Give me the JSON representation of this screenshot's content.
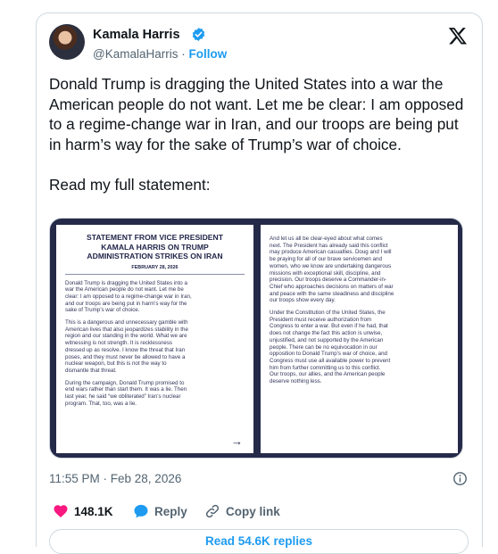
{
  "author": {
    "name": "Kamala Harris",
    "handle": "@KamalaHarris",
    "separator": "·",
    "follow_label": "Follow"
  },
  "tweet": {
    "text": "Donald Trump is dragging the United States into a war the American people do not want. Let me be clear: I am opposed to a regime-change war in Iran, and our troops are being put in harm’s way for the sake of Trump’s war of choice.\n\nRead my full statement:"
  },
  "statement": {
    "title": "STATEMENT FROM VICE PRESIDENT\nKAMALA HARRIS ON TRUMP\nADMINISTRATION STRIKES ON IRAN",
    "date": "FEBRUARY 28, 2026",
    "left_paragraphs": [
      "Donald Trump is dragging the United States into a\nwar the American people do not want. Let me be\nclear: I am opposed to a regime-change war in Iran,\nand our troops are being put in harm’s way for the\nsake of Trump’s war of choice.",
      "This is a dangerous and unnecessary gamble with\nAmerican lives that also jeopardizes stability in the\nregion and our standing in the world. What we are\nwitnessing is not strength. It is recklessness\ndressed up as resolve. I know the threat that Iran\nposes, and they must never be allowed to have a\nnuclear weapon, but this is not the way to\ndismantle that threat.",
      "During the campaign, Donald Trump promised to\nend wars rather than start them. It was a lie. Then\nlast year, he said “we obliterated” Iran’s nuclear\nprogram. That, too, was a lie."
    ],
    "right_paragraphs": [
      "And let us all be clear-eyed about what comes\nnext. The President has already said this conflict\nmay produce American casualties. Doug and I will\nbe praying for all of our brave servicemen and\nwomen, who we know are undertaking dangerous\nmissions with exceptional skill, discipline, and\nprecision. Our troops deserve a Commander-in-\nChief who approaches decisions on matters of war\nand peace with the same steadiness and discipline\nour troops show every day.",
      "Under the Constitution of the United States, the\nPresident must receive authorization from\nCongress to enter a war. But even if he had, that\ndoes not change the fact this action is unwise,\nunjustified, and not supported by the American\npeople. There can be no equivocation in our\nopposition to Donald Trump’s war of choice, and\nCongress must use all available power to prevent\nhim from further committing us to this conflict.\nOur troops, our allies, and the American people\ndeserve nothing less."
    ],
    "arrow": "→"
  },
  "meta": {
    "timestamp": "11:55 PM · Feb 28, 2026"
  },
  "actions": {
    "like_count": "148.1K",
    "reply_label": "Reply",
    "copy_label": "Copy link"
  },
  "replies_button": "Read 54.6K replies",
  "colors": {
    "accent": "#1d9bf0",
    "like": "#f91880",
    "statement_bg": "#262a49"
  },
  "icons": [
    "verified-badge-icon",
    "x-logo-icon",
    "info-icon",
    "heart-icon",
    "reply-bubble-icon",
    "link-icon"
  ]
}
